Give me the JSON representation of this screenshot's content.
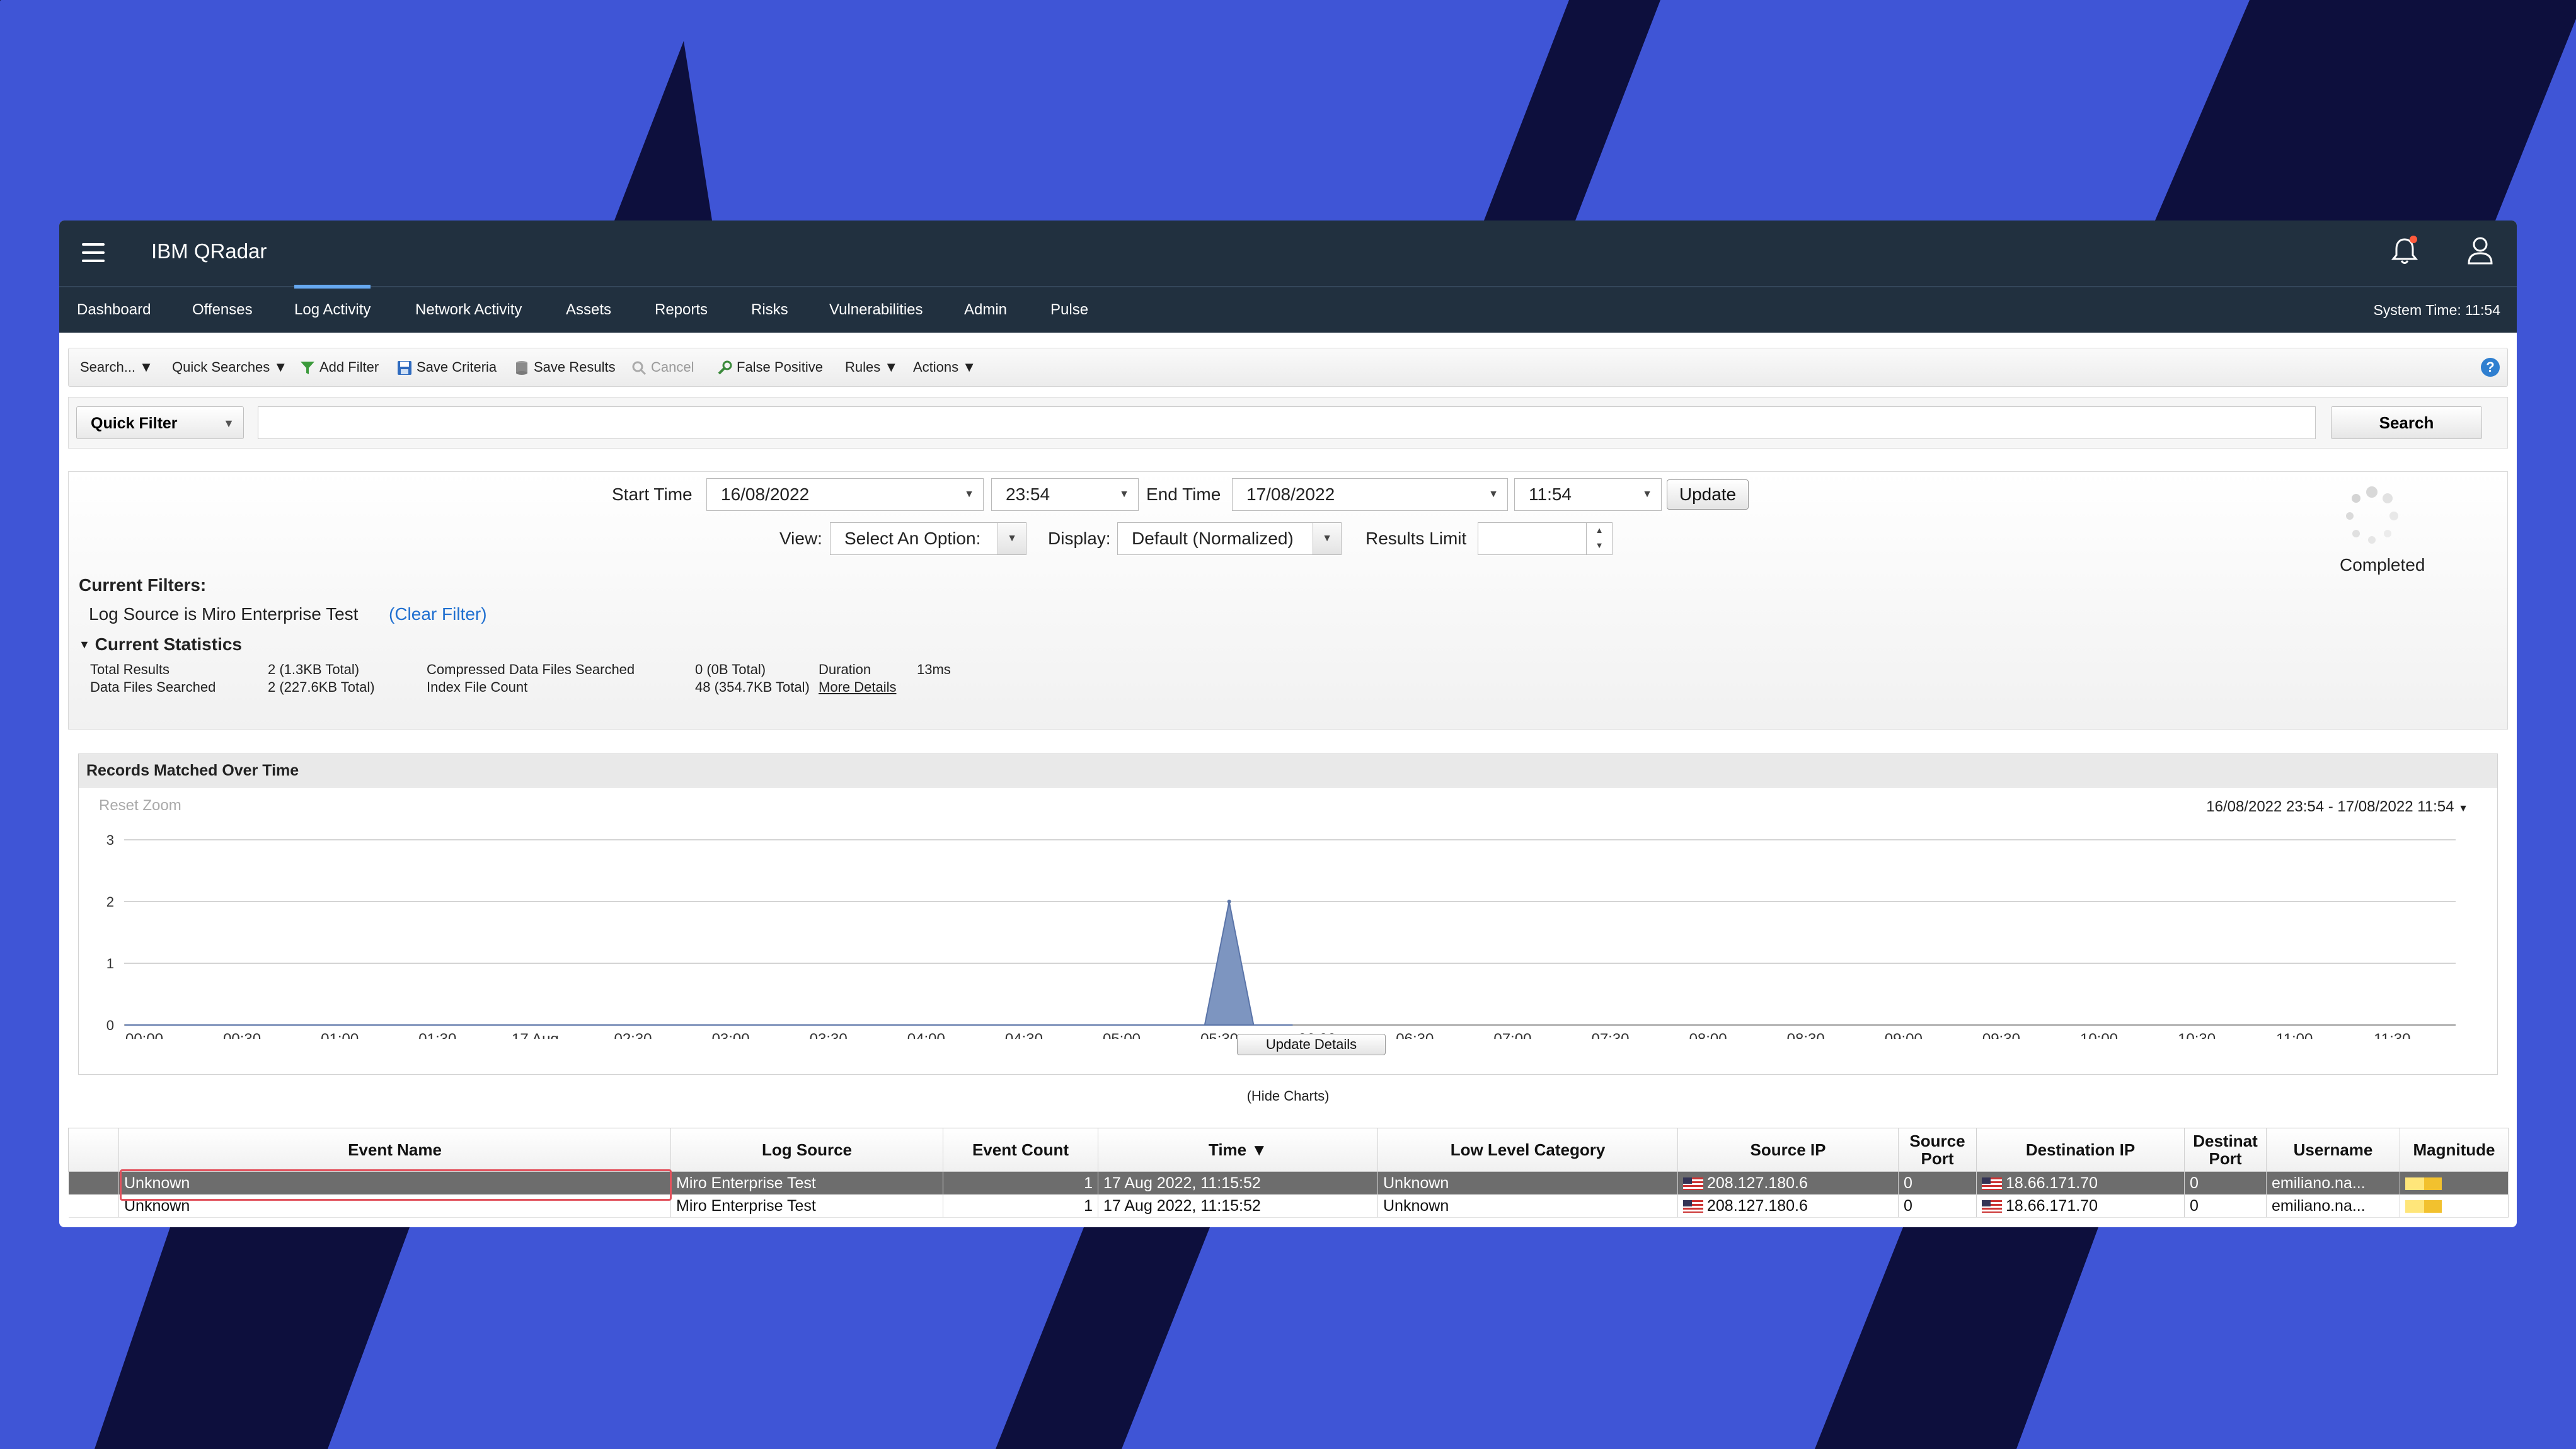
{
  "app": {
    "title": "IBM QRadar",
    "system_time": "System Time: 11:54"
  },
  "nav": {
    "tabs": [
      "Dashboard",
      "Offenses",
      "Log Activity",
      "Network Activity",
      "Assets",
      "Reports",
      "Risks",
      "Vulnerabilities",
      "Admin",
      "Pulse"
    ],
    "active_tab": "Log Activity"
  },
  "toolbar": {
    "search": "Search... ▼",
    "quick_searches": "Quick Searches ▼",
    "add_filter": "Add Filter",
    "save_criteria": "Save Criteria",
    "save_results": "Save Results",
    "cancel": "Cancel",
    "false_positive": "False Positive",
    "rules": "Rules ▼",
    "actions": "Actions ▼",
    "help": "?"
  },
  "filter_bar": {
    "quick_filter_label": "Quick Filter",
    "input_value": "",
    "search_button": "Search"
  },
  "criteria": {
    "start_time_label": "Start Time",
    "start_date": "16/08/2022",
    "start_time": "23:54",
    "end_time_label": "End Time",
    "end_date": "17/08/2022",
    "end_time": "11:54",
    "update_button": "Update",
    "view_label": "View:",
    "view_value": "Select An Option:",
    "display_label": "Display:",
    "display_value": "Default (Normalized)",
    "results_limit_label": "Results Limit",
    "results_limit_value": "",
    "status": "Completed",
    "current_filters_label": "Current Filters:",
    "filter_text": "Log Source is Miro Enterprise Test",
    "clear_filter": "(Clear Filter)",
    "stats_label": "Current Statistics",
    "stats": {
      "total_results_label": "Total Results",
      "total_results": "2 (1.3KB Total)",
      "data_files_label": "Data Files Searched",
      "data_files": "2 (227.6KB Total)",
      "compressed_label": "Compressed Data Files Searched",
      "compressed": "0 (0B Total)",
      "index_label": "Index File Count",
      "index": "48 (354.7KB Total)",
      "more_details": "More Details",
      "duration_label": "Duration",
      "duration": "13ms"
    }
  },
  "chart_panel": {
    "title": "Records Matched Over Time",
    "reset_zoom": "Reset Zoom",
    "range_label": "16/08/2022 23:54 - 17/08/2022 11:54",
    "update_details": "Update Details",
    "hide_charts": "(Hide Charts)"
  },
  "chart_data": {
    "type": "area",
    "title": "Records Matched Over Time",
    "x": [
      "00:00",
      "00:30",
      "01:00",
      "01:30",
      "17 Aug",
      "02:30",
      "03:00",
      "03:30",
      "04:00",
      "04:30",
      "05:00",
      "05:30",
      "06:00",
      "06:30",
      "07:00",
      "07:30",
      "08:00",
      "08:30",
      "09:00",
      "09:30",
      "10:00",
      "10:30",
      "11:00",
      "11:30"
    ],
    "series": [
      {
        "points": [
          [
            -0.2,
            0
          ],
          [
            10.85,
            0
          ],
          [
            11.1,
            2
          ],
          [
            11.35,
            0
          ],
          [
            11.75,
            0
          ]
        ]
      }
    ],
    "ylim": [
      0,
      3
    ],
    "yticks": [
      "0",
      "1",
      "2",
      "3"
    ],
    "grid": true,
    "fill_color": "#7d95c0",
    "line_color": "#5a74a8"
  },
  "table": {
    "columns": [
      "",
      "Event Name",
      "Log Source",
      "Event Count",
      "Time ▼",
      "Low Level Category",
      "Source IP",
      "Source Port",
      "Destination IP",
      "Destinat Port",
      "Username",
      "Magnitude"
    ],
    "rows": [
      {
        "event_name": "Unknown",
        "log_source": "Miro Enterprise Test",
        "event_count": "1",
        "time": "17 Aug 2022, 11:15:52",
        "category": "Unknown",
        "source_ip": "208.127.180.6",
        "source_port": "0",
        "destination_ip": "18.66.171.70",
        "destination_port": "0",
        "username": "emiliano.na...",
        "selected": true
      },
      {
        "event_name": "Unknown",
        "log_source": "Miro Enterprise Test",
        "event_count": "1",
        "time": "17 Aug 2022, 11:15:52",
        "category": "Unknown",
        "source_ip": "208.127.180.6",
        "source_port": "0",
        "destination_ip": "18.66.171.70",
        "destination_port": "0",
        "username": "emiliano.na...",
        "selected": false
      }
    ]
  },
  "colors": {
    "background": "#3f55d6",
    "stripes": "#0d0f3d",
    "header": "#21303f",
    "active_tab_indicator": "#66a8f0",
    "selected_row": "#6d6d6d",
    "highlight": "#e2535e",
    "notification_dot": "#ff5a3c"
  }
}
